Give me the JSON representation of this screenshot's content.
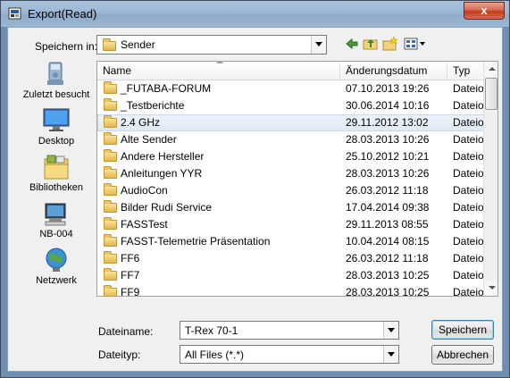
{
  "window": {
    "title": "Export(Read)",
    "close_glyph": "x"
  },
  "location": {
    "label": "Speichern in:",
    "value": "Sender"
  },
  "toolbar": {
    "icons": [
      "back-icon",
      "up-folder-icon",
      "new-folder-icon",
      "view-menu-icon"
    ]
  },
  "places": [
    {
      "label": "Zuletzt besucht",
      "icon": "recent-places-icon"
    },
    {
      "label": "Desktop",
      "icon": "desktop-icon"
    },
    {
      "label": "Bibliotheken",
      "icon": "libraries-icon"
    },
    {
      "label": "NB-004",
      "icon": "computer-icon"
    },
    {
      "label": "Netzwerk",
      "icon": "network-icon"
    }
  ],
  "columns": {
    "name": "Name",
    "date": "Änderungsdatum",
    "type": "Typ"
  },
  "files": [
    {
      "name": "_FUTABA-FORUM",
      "date": "07.10.2013 19:26",
      "type": "Dateio"
    },
    {
      "name": "_Testberichte",
      "date": "30.06.2014 10:16",
      "type": "Dateio"
    },
    {
      "name": "2.4 GHz",
      "date": "29.11.2012 13:02",
      "type": "Dateio",
      "selected": true
    },
    {
      "name": "Alte Sender",
      "date": "28.03.2013 10:26",
      "type": "Dateio"
    },
    {
      "name": "Andere Hersteller",
      "date": "25.10.2012 10:21",
      "type": "Dateio"
    },
    {
      "name": "Anleitungen YYR",
      "date": "28.03.2013 10:26",
      "type": "Dateio"
    },
    {
      "name": "AudioCon",
      "date": "26.03.2012 11:18",
      "type": "Dateio"
    },
    {
      "name": "Bilder Rudi Service",
      "date": "17.04.2014 09:38",
      "type": "Dateio"
    },
    {
      "name": "FASSTest",
      "date": "29.11.2013 08:55",
      "type": "Dateio"
    },
    {
      "name": "FASST-Telemetrie Präsentation",
      "date": "10.04.2014 08:15",
      "type": "Dateio"
    },
    {
      "name": "FF6",
      "date": "26.03.2012 11:18",
      "type": "Dateio"
    },
    {
      "name": "FF7",
      "date": "28.03.2013 10:25",
      "type": "Dateio"
    },
    {
      "name": "FF9",
      "date": "28.03.2013 10:25",
      "type": "Dateio"
    }
  ],
  "filename": {
    "label": "Dateiname:",
    "value": "T-Rex 70-1"
  },
  "filetype": {
    "label": "Dateityp:",
    "value": "All Files (*.*)"
  },
  "buttons": {
    "save": "Speichern",
    "cancel": "Abbrechen"
  }
}
